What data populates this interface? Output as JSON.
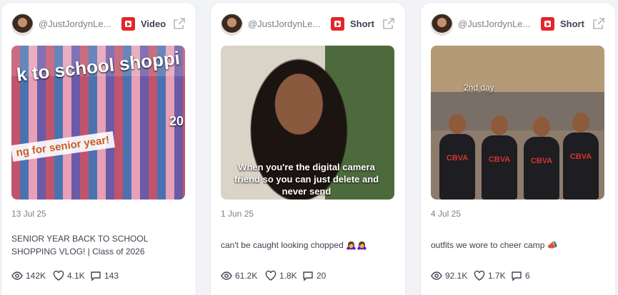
{
  "cards": [
    {
      "handle": "@JustJordynLe...",
      "platform_icon": "youtube-icon",
      "post_type": "Video",
      "thumbnail_text": [
        "k to school shoppi",
        "ng for senior year!",
        "20"
      ],
      "date": "13 Jul 25",
      "caption": "SENIOR YEAR BACK TO SCHOOL SHOPPING VLOG! | Class of 2026",
      "views": "142K",
      "likes": "4.1K",
      "comments": "143"
    },
    {
      "handle": "@JustJordynLe...",
      "platform_icon": "youtube-icon",
      "post_type": "Short",
      "thumbnail_text": [
        "When you're the digital camera friend so you can just delete and never send"
      ],
      "date": "1 Jun 25",
      "caption": "can't be caught looking chopped 🙇‍♀️🙇‍♀️",
      "views": "61.2K",
      "likes": "1.8K",
      "comments": "20"
    },
    {
      "handle": "@JustJordynLe...",
      "platform_icon": "youtube-icon",
      "post_type": "Short",
      "thumbnail_text": [
        "2nd day",
        "CBVA"
      ],
      "date": "4 Jul 25",
      "caption": "outfits we wore to cheer camp 📣",
      "views": "92.1K",
      "likes": "1.7K",
      "comments": "6"
    }
  ],
  "colors": {
    "brand_red": "#e1262c",
    "text": "#3e4450",
    "muted": "#7b808a",
    "background": "#f1f3f7"
  }
}
